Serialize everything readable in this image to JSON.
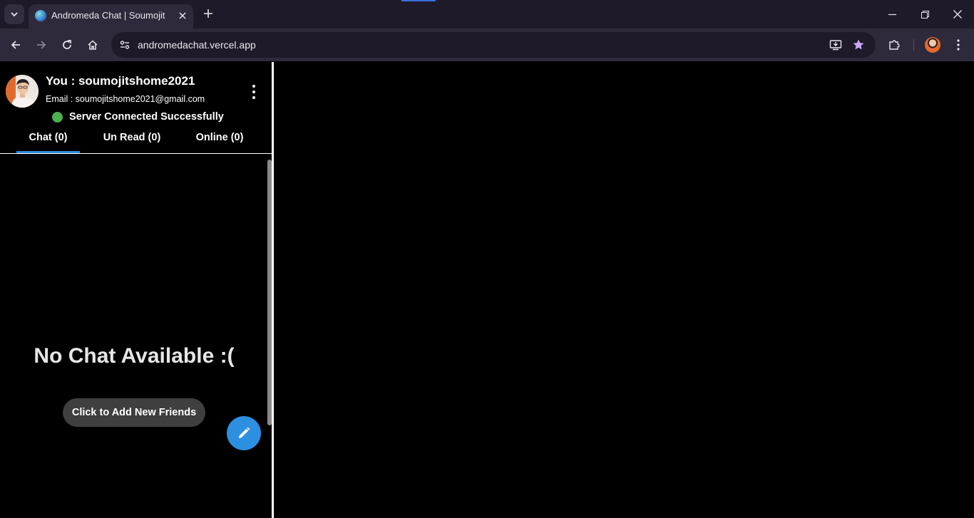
{
  "browser": {
    "tab_title": "Andromeda Chat | Soumojit",
    "url": "andromedachat.vercel.app",
    "icons": {
      "tab_search": "chevron-down-icon",
      "favicon": "globe-icon",
      "tab_close": "close-icon",
      "new_tab": "plus-icon",
      "minimize": "minimize-icon",
      "restore": "restore-icon",
      "close_window": "close-icon",
      "back": "arrow-left-icon",
      "forward": "arrow-right-icon",
      "reload": "reload-icon",
      "home": "home-icon",
      "site_info": "tune-icon",
      "install": "install-app-icon",
      "bookmark": "star-icon",
      "extensions": "puzzle-icon",
      "menu": "kebab-icon"
    },
    "colors": {
      "frame": "#1f1a29",
      "toolbar": "#2f2a3b",
      "star": "#c7a7ff"
    }
  },
  "user": {
    "display": "You : soumojitshome2021",
    "email_line": "Email : soumojitshome2021@gmail.com"
  },
  "status": {
    "text": "Server Connected Successfully",
    "color": "#4caf50"
  },
  "tabs": [
    {
      "label": "Chat (0)",
      "active": true
    },
    {
      "label": "Un Read (0)",
      "active": false
    },
    {
      "label": "Online (0)",
      "active": false
    }
  ],
  "empty_state": {
    "title": "No Chat Available :(",
    "button_label": "Click to Add New Friends"
  },
  "fab": {
    "icon": "pencil-icon",
    "color": "#2d8fe0"
  },
  "accent": "#2e8ad8"
}
